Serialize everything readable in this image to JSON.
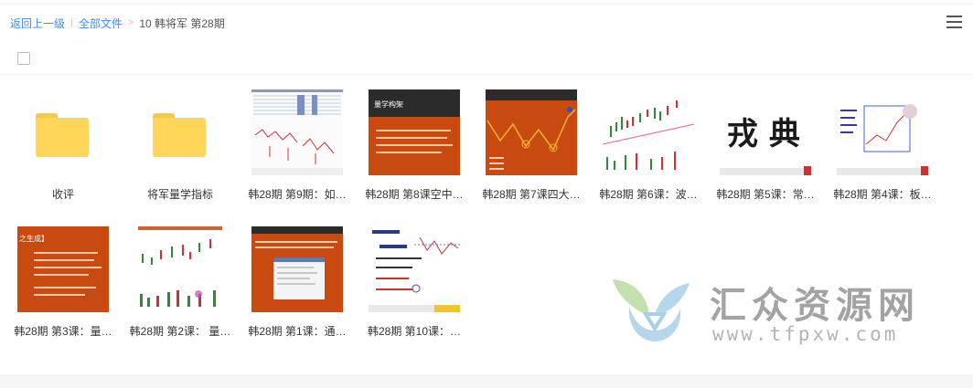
{
  "breadcrumb": {
    "back": "返回上一级",
    "all_files": "全部文件",
    "separator": "|",
    "arrow": ">",
    "current": "10 韩将军 第28期"
  },
  "files": [
    {
      "name": "收评",
      "type": "folder"
    },
    {
      "name": "将军量学指标",
      "type": "folder"
    },
    {
      "name": "韩28期 第9期：如…",
      "type": "image"
    },
    {
      "name": "韩28期 第8课空中…",
      "type": "image"
    },
    {
      "name": "韩28期 第7课四大…",
      "type": "image"
    },
    {
      "name": "韩28期 第6课：波…",
      "type": "image"
    },
    {
      "name": "韩28期 第5课：常…",
      "type": "image"
    },
    {
      "name": "韩28期 第4课：板…",
      "type": "image"
    },
    {
      "name": "韩28期 第3课：量…",
      "type": "image"
    },
    {
      "name": "韩28期 第2课： 量…",
      "type": "image"
    },
    {
      "name": "韩28期 第1课：通…",
      "type": "image"
    },
    {
      "name": "韩28期 第10课：…",
      "type": "image"
    }
  ],
  "thumb_text": {
    "t8_heading": "量学构架",
    "t5_chars": "戎 典",
    "t3_heading": "之生成】"
  },
  "watermark": {
    "title": "汇众资源网",
    "url": "www.tfpxw.com"
  },
  "colors": {
    "link": "#3b8cff",
    "folder": "#ffd659",
    "ppt_orange": "#c94a10",
    "ppt_dark": "#2b2b2b"
  }
}
